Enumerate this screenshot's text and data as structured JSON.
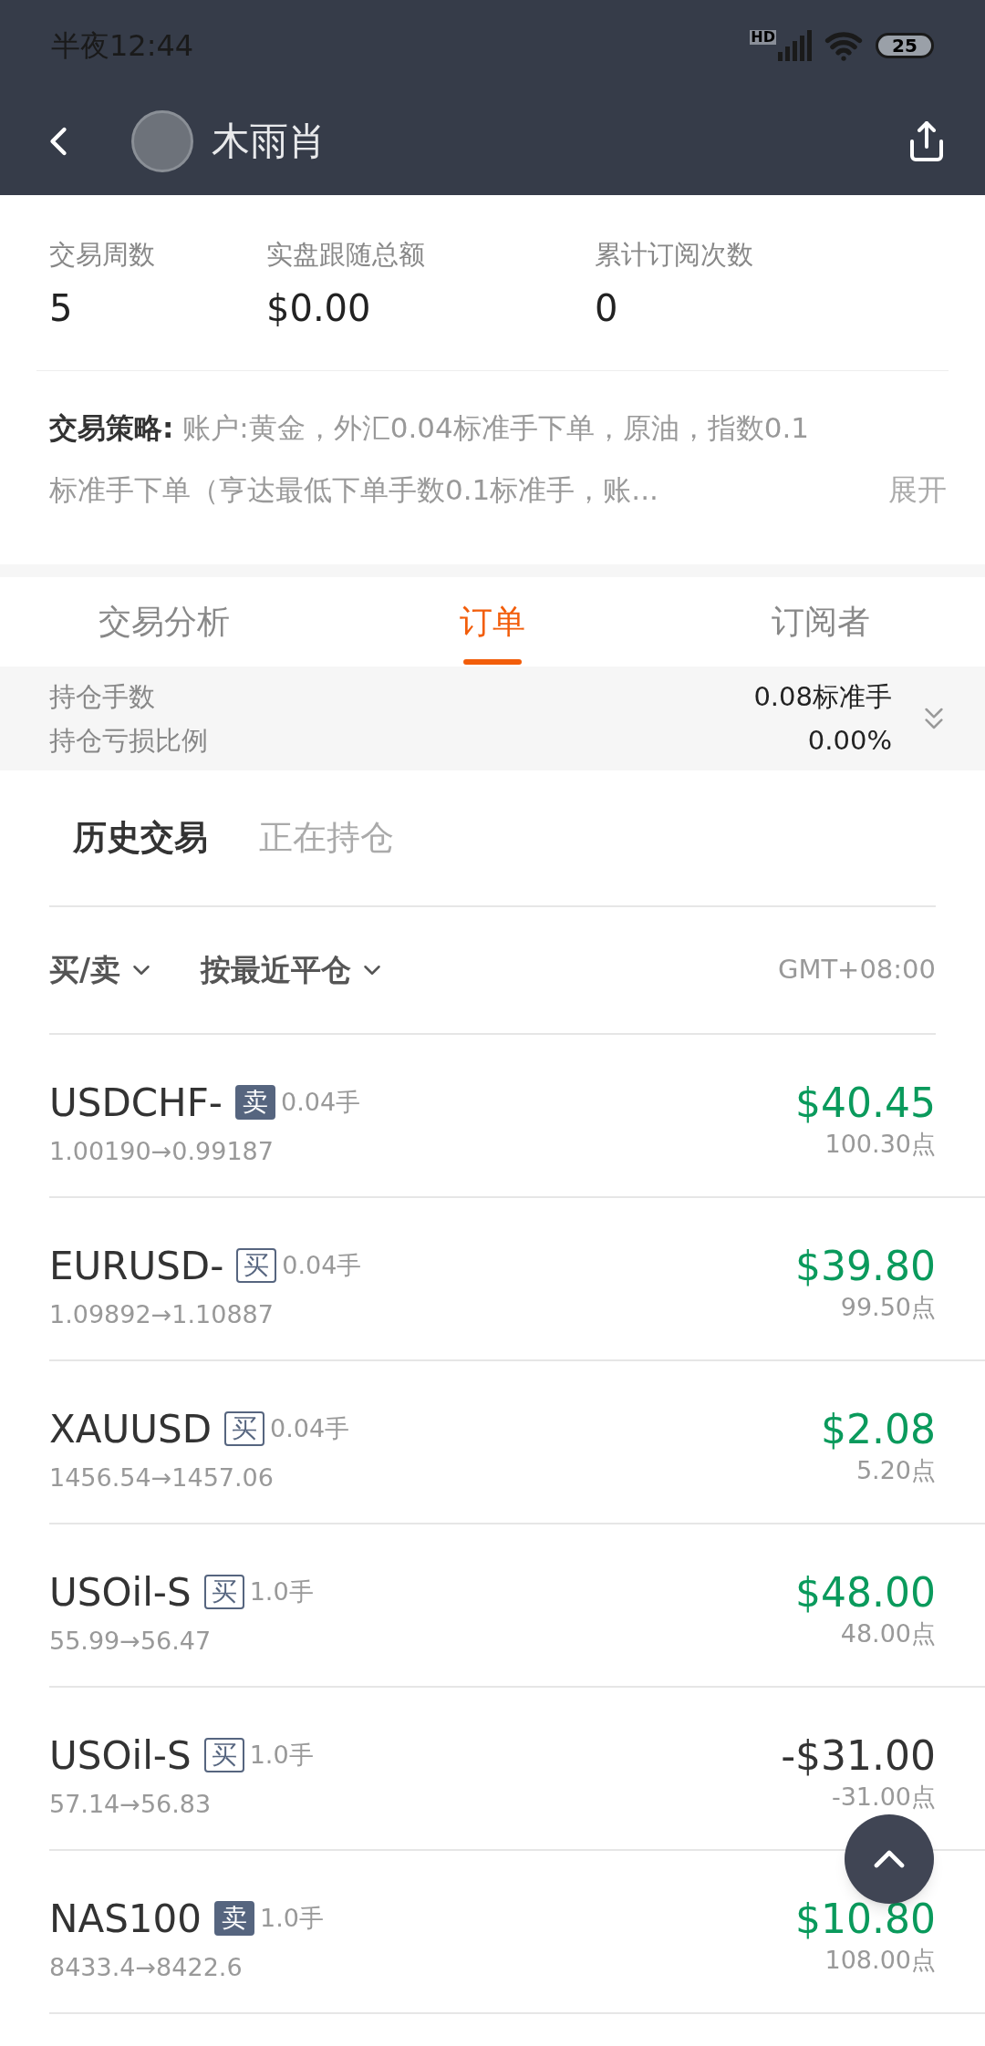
{
  "status_bar": {
    "time": "半夜12:44",
    "network": "HD",
    "battery": "25"
  },
  "header": {
    "title": "木雨肖"
  },
  "stats": [
    {
      "label": "交易周数",
      "value": "5"
    },
    {
      "label": "实盘跟随总额",
      "value": "$0.00"
    },
    {
      "label": "累计订阅次数",
      "value": "0"
    }
  ],
  "strategy": {
    "label": "交易策略:",
    "text": "账户:黄金，外汇0.04标准手下单，原油，指数0.1标准手下单（亨达最低下单手数0.1标准手，账...",
    "expand": "展开"
  },
  "tabs": [
    {
      "label": "交易分析",
      "selected": false
    },
    {
      "label": "订单",
      "selected": true
    },
    {
      "label": "订阅者",
      "selected": false
    }
  ],
  "summary": [
    {
      "label": "持仓手数",
      "value": "0.08标准手"
    },
    {
      "label": "持仓亏损比例",
      "value": "0.00%"
    }
  ],
  "subtabs": [
    {
      "label": "历史交易",
      "selected": true
    },
    {
      "label": "正在持仓",
      "selected": false
    }
  ],
  "filters": [
    {
      "label": "买/卖"
    },
    {
      "label": "按最近平仓"
    }
  ],
  "timezone": "GMT+08:00",
  "orders": [
    {
      "symbol": "USDCHF-",
      "kind": "sell",
      "side": "卖",
      "lots": "0.04手",
      "prices": "1.00190→0.99187",
      "amount": "$40.45",
      "points": "100.30点",
      "profit": true
    },
    {
      "symbol": "EURUSD-",
      "kind": "buy",
      "side": "买",
      "lots": "0.04手",
      "prices": "1.09892→1.10887",
      "amount": "$39.80",
      "points": "99.50点",
      "profit": true
    },
    {
      "symbol": "XAUUSD",
      "kind": "buy",
      "side": "买",
      "lots": "0.04手",
      "prices": "1456.54→1457.06",
      "amount": "$2.08",
      "points": "5.20点",
      "profit": true
    },
    {
      "symbol": "USOil-S",
      "kind": "buy",
      "side": "买",
      "lots": "1.0手",
      "prices": "55.99→56.47",
      "amount": "$48.00",
      "points": "48.00点",
      "profit": true
    },
    {
      "symbol": "USOil-S",
      "kind": "buy",
      "side": "买",
      "lots": "1.0手",
      "prices": "57.14→56.83",
      "amount": "-$31.00",
      "points": "-31.00点",
      "profit": false
    },
    {
      "symbol": "NAS100",
      "kind": "sell",
      "side": "卖",
      "lots": "1.0手",
      "prices": "8433.4→8422.6",
      "amount": "$10.80",
      "points": "108.00点",
      "profit": true
    }
  ]
}
